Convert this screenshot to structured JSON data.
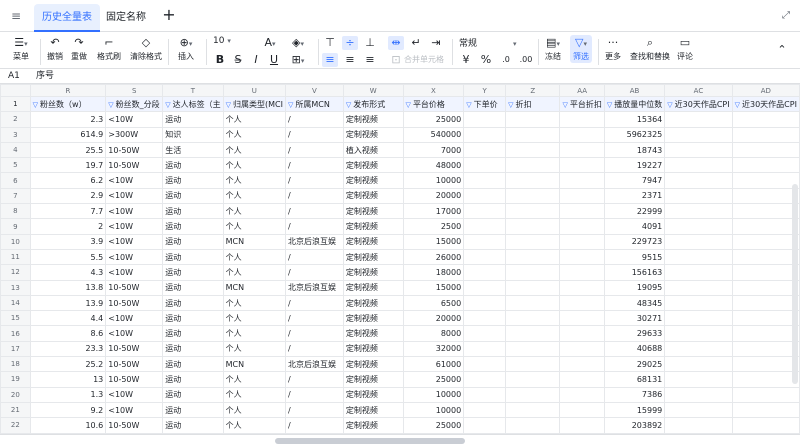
{
  "tabs": [
    {
      "label": "历史全量表",
      "active": true
    },
    {
      "label": "固定名称",
      "active": false
    }
  ],
  "toolbar": {
    "menu": "菜单",
    "undo": "撤销",
    "redo": "重做",
    "format_painter": "格式刷",
    "clear_format": "清除格式",
    "insert": "插入",
    "font_size": "10",
    "number_format": "常规",
    "merge": "合并单元格",
    "freeze": "冻结",
    "filter": "筛选",
    "more": "更多",
    "find_replace": "查找和替换",
    "comment": "评论"
  },
  "formula_bar": {
    "cell_ref": "A1",
    "content": "序号"
  },
  "columns": [
    "R",
    "S",
    "T",
    "U",
    "V",
    "W",
    "X",
    "Y",
    "Z",
    "AA",
    "AB",
    "AC",
    "AD"
  ],
  "header_row": [
    "粉丝数（w）",
    "粉丝数_分段",
    "达人标签（主",
    "归属类型(MCI",
    "所属MCN",
    "发布形式",
    "平台价格",
    "下单价",
    "折扣",
    "平台折扣",
    "播放量中位数",
    "近30天作品CPI",
    "近30天作品CPI"
  ],
  "rows": [
    {
      "n": "2",
      "c": [
        "2.3",
        "<10W",
        "运动",
        "个人",
        "/",
        "定制视频",
        "25000",
        "",
        "",
        "",
        "15364",
        "",
        ""
      ]
    },
    {
      "n": "3",
      "c": [
        "614.9",
        ">300W",
        "知识",
        "个人",
        "/",
        "定制视频",
        "540000",
        "",
        "",
        "",
        "5962325",
        "",
        ""
      ]
    },
    {
      "n": "4",
      "c": [
        "25.5",
        "10-50W",
        "生活",
        "个人",
        "/",
        "植入视频",
        "7000",
        "",
        "",
        "",
        "18743",
        "",
        ""
      ]
    },
    {
      "n": "5",
      "c": [
        "19.7",
        "10-50W",
        "运动",
        "个人",
        "/",
        "定制视频",
        "48000",
        "",
        "",
        "",
        "19227",
        "",
        ""
      ]
    },
    {
      "n": "6",
      "c": [
        "6.2",
        "<10W",
        "运动",
        "个人",
        "/",
        "定制视频",
        "10000",
        "",
        "",
        "",
        "7947",
        "",
        ""
      ]
    },
    {
      "n": "7",
      "c": [
        "2.9",
        "<10W",
        "运动",
        "个人",
        "/",
        "定制视频",
        "20000",
        "",
        "",
        "",
        "2371",
        "",
        ""
      ]
    },
    {
      "n": "8",
      "c": [
        "7.7",
        "<10W",
        "运动",
        "个人",
        "/",
        "定制视频",
        "17000",
        "",
        "",
        "",
        "22999",
        "",
        ""
      ]
    },
    {
      "n": "9",
      "c": [
        "2",
        "<10W",
        "运动",
        "个人",
        "/",
        "定制视频",
        "2500",
        "",
        "",
        "",
        "4091",
        "",
        ""
      ]
    },
    {
      "n": "10",
      "c": [
        "3.9",
        "<10W",
        "运动",
        "MCN",
        "北京后浪互娱",
        "定制视频",
        "15000",
        "",
        "",
        "",
        "229723",
        "",
        ""
      ]
    },
    {
      "n": "11",
      "c": [
        "5.5",
        "<10W",
        "运动",
        "个人",
        "/",
        "定制视频",
        "26000",
        "",
        "",
        "",
        "9515",
        "",
        ""
      ]
    },
    {
      "n": "12",
      "c": [
        "4.3",
        "<10W",
        "运动",
        "个人",
        "/",
        "定制视频",
        "18000",
        "",
        "",
        "",
        "156163",
        "",
        ""
      ]
    },
    {
      "n": "13",
      "c": [
        "13.8",
        "10-50W",
        "运动",
        "MCN",
        "北京后浪互娱",
        "定制视频",
        "15000",
        "",
        "",
        "",
        "19095",
        "",
        ""
      ]
    },
    {
      "n": "14",
      "c": [
        "13.9",
        "10-50W",
        "运动",
        "个人",
        "/",
        "定制视频",
        "6500",
        "",
        "",
        "",
        "48345",
        "",
        ""
      ]
    },
    {
      "n": "15",
      "c": [
        "4.4",
        "<10W",
        "运动",
        "个人",
        "/",
        "定制视频",
        "20000",
        "",
        "",
        "",
        "30271",
        "",
        ""
      ]
    },
    {
      "n": "16",
      "c": [
        "8.6",
        "<10W",
        "运动",
        "个人",
        "/",
        "定制视频",
        "8000",
        "",
        "",
        "",
        "29633",
        "",
        ""
      ]
    },
    {
      "n": "17",
      "c": [
        "23.3",
        "10-50W",
        "运动",
        "个人",
        "/",
        "定制视频",
        "32000",
        "",
        "",
        "",
        "40688",
        "",
        ""
      ]
    },
    {
      "n": "18",
      "c": [
        "25.2",
        "10-50W",
        "运动",
        "MCN",
        "北京后浪互娱",
        "定制视频",
        "61000",
        "",
        "",
        "",
        "29025",
        "",
        ""
      ]
    },
    {
      "n": "19",
      "c": [
        "13",
        "10-50W",
        "运动",
        "个人",
        "/",
        "定制视频",
        "25000",
        "",
        "",
        "",
        "68131",
        "",
        ""
      ]
    },
    {
      "n": "20",
      "c": [
        "1.3",
        "<10W",
        "运动",
        "个人",
        "/",
        "定制视频",
        "10000",
        "",
        "",
        "",
        "7386",
        "",
        ""
      ]
    },
    {
      "n": "21",
      "c": [
        "9.2",
        "<10W",
        "运动",
        "个人",
        "/",
        "定制视频",
        "10000",
        "",
        "",
        "",
        "15999",
        "",
        ""
      ]
    },
    {
      "n": "22",
      "c": [
        "10.6",
        "10-50W",
        "运动",
        "个人",
        "/",
        "定制视频",
        "25000",
        "",
        "",
        "",
        "203892",
        "",
        ""
      ]
    }
  ]
}
